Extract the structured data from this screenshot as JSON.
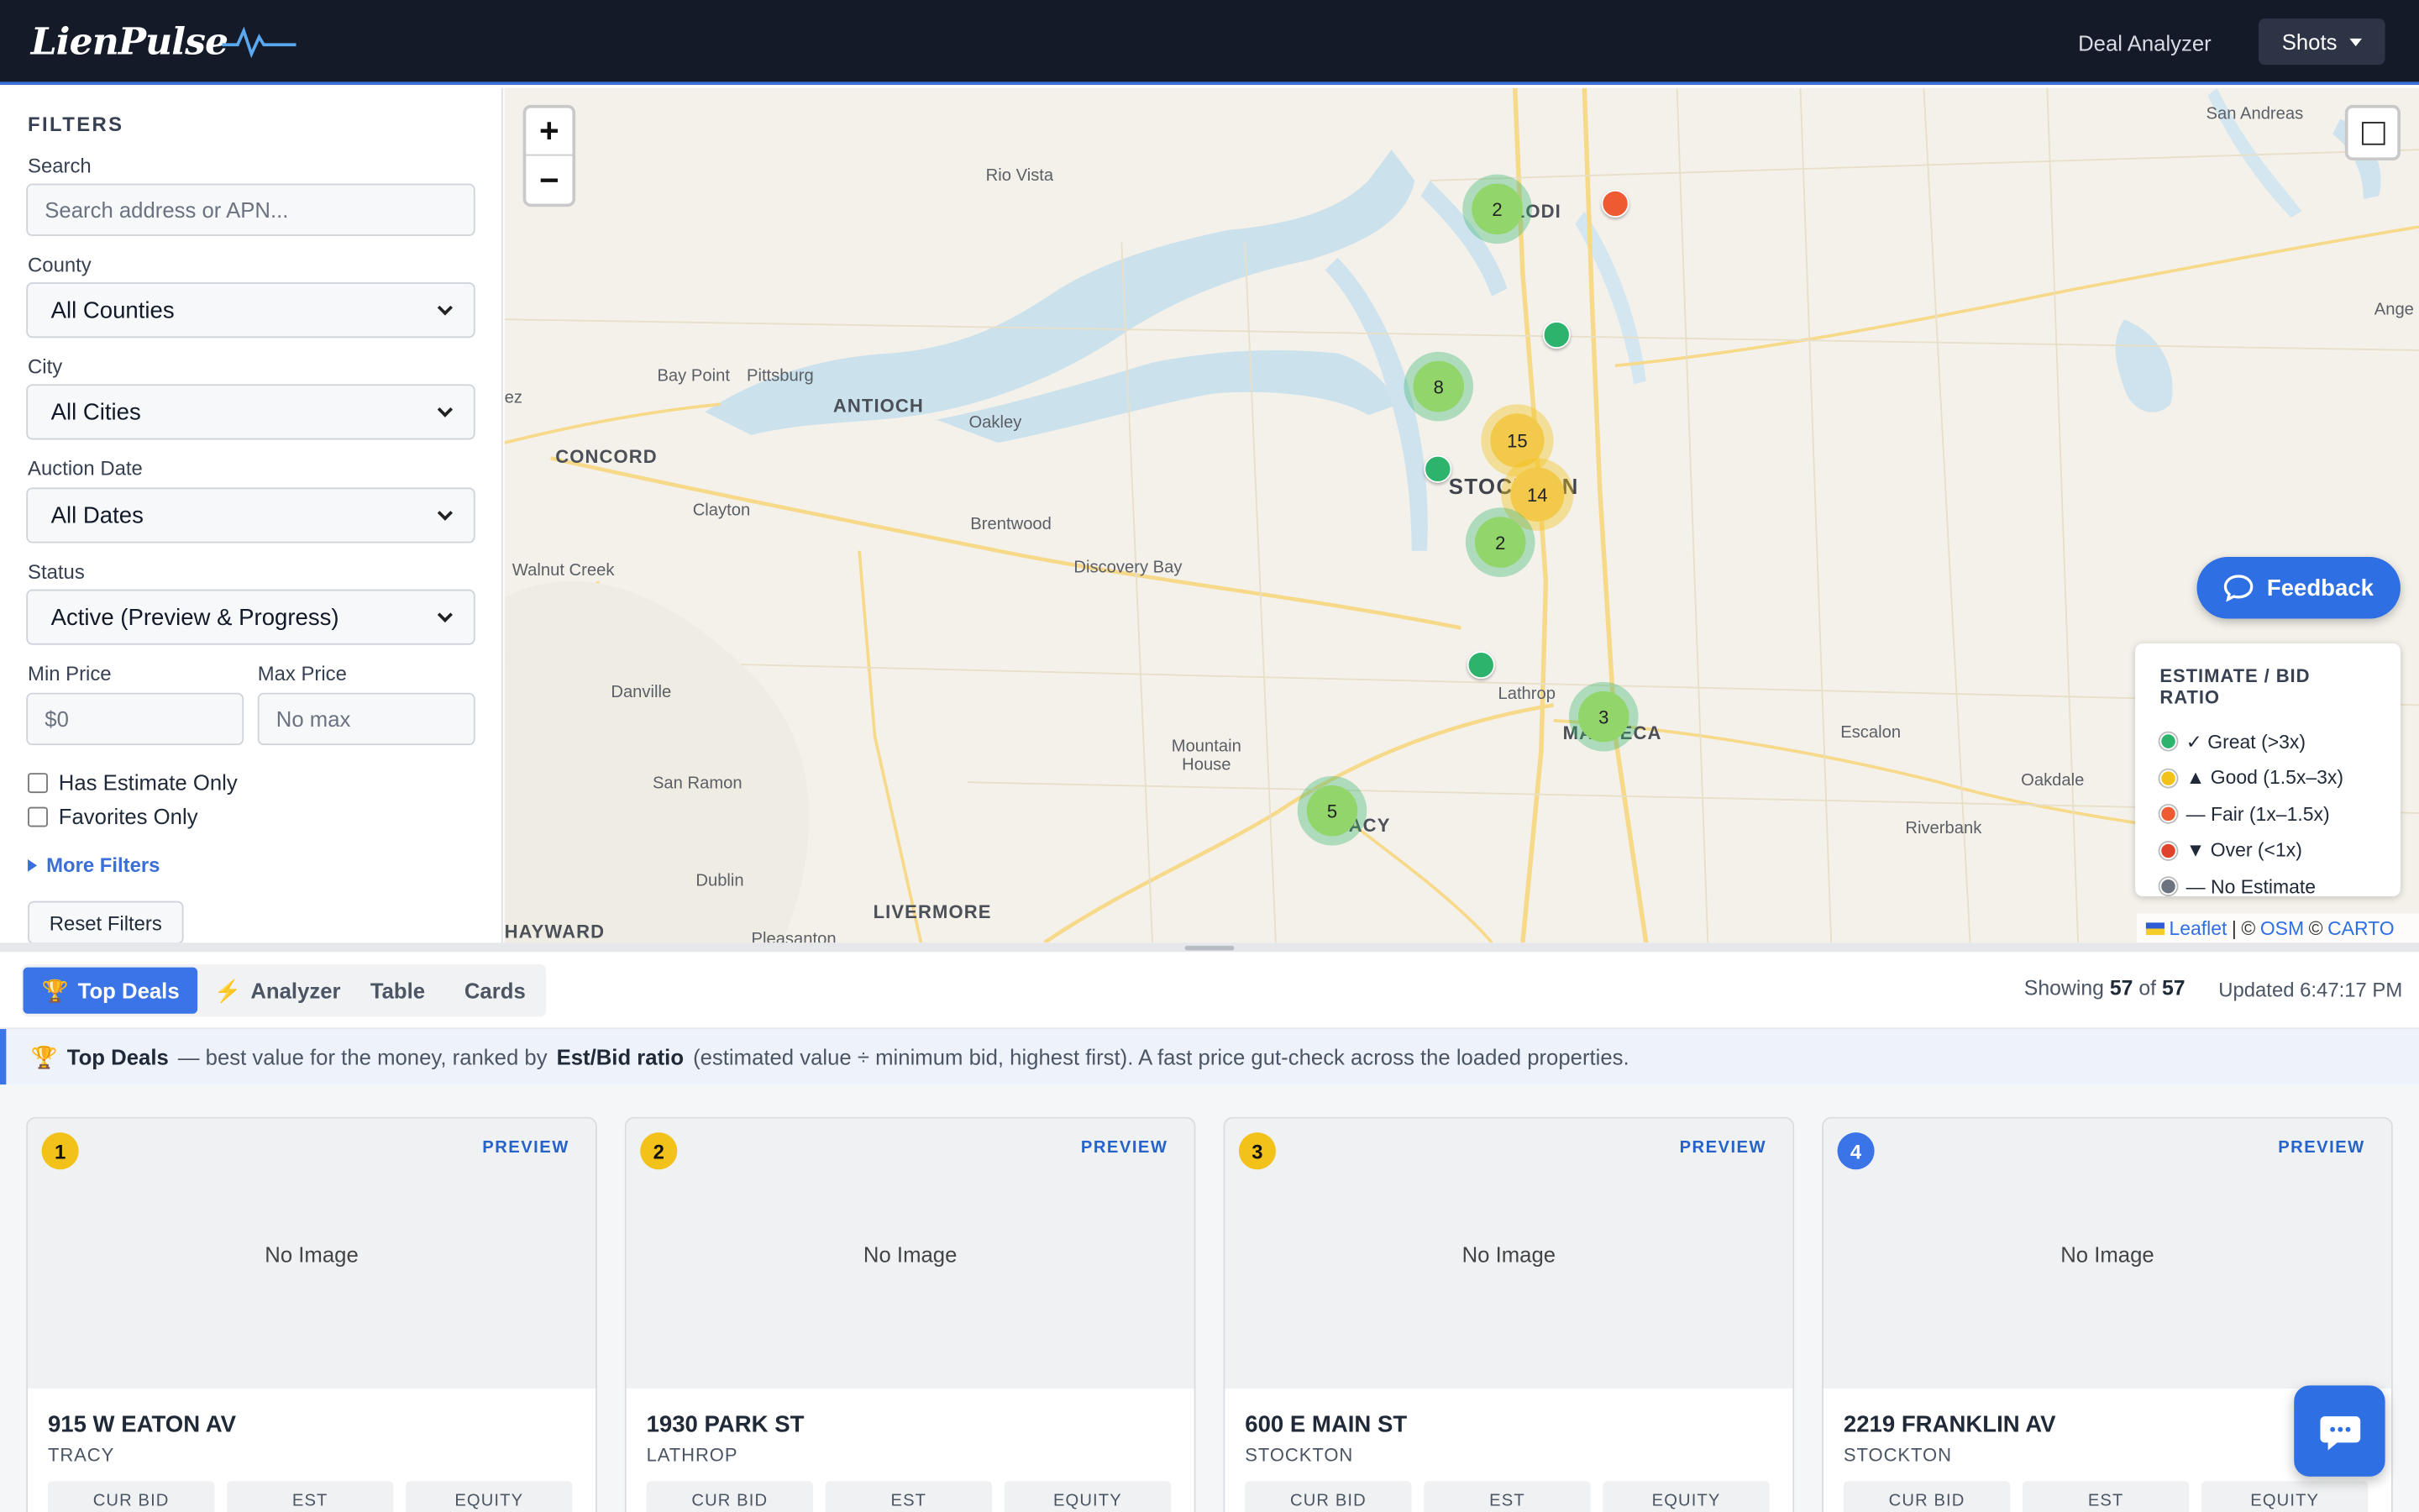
{
  "app": {
    "logo_text": "LienPulse",
    "nav_link": "Deal Analyzer",
    "menu_button": "Shots"
  },
  "filters": {
    "title": "FILTERS",
    "search": {
      "label": "Search",
      "placeholder": "Search address or APN..."
    },
    "county": {
      "label": "County",
      "value": "All Counties"
    },
    "city": {
      "label": "City",
      "value": "All Cities"
    },
    "auction_date": {
      "label": "Auction Date",
      "value": "All Dates"
    },
    "status": {
      "label": "Status",
      "value": "Active (Preview & Progress)"
    },
    "min_price": {
      "label": "Min Price",
      "placeholder": "$0"
    },
    "max_price": {
      "label": "Max Price",
      "placeholder": "No max"
    },
    "has_estimate": {
      "label": "Has Estimate Only",
      "checked": false
    },
    "favorites": {
      "label": "Favorites Only",
      "checked": false
    },
    "more_filters": "More Filters",
    "reset": "Reset Filters"
  },
  "map": {
    "zoom_in": "+",
    "zoom_out": "−",
    "places": [
      "San Andreas",
      "Rio Vista",
      "LODI",
      "Ange",
      "Bay Point",
      "Pittsburg",
      "ez",
      "ANTIOCH",
      "Oakley",
      "CONCORD",
      "STOCKTON",
      "Clayton",
      "Brentwood",
      "Walnut Creek",
      "Discovery Bay",
      "Danville",
      "Lathrop",
      "MANTECA",
      "Escalon",
      "Mountain House",
      "San Ramon",
      "TRACY",
      "Oakdale",
      "Riverbank",
      "Dublin",
      "LIVERMORE",
      "HAYWARD",
      "Pleasanton"
    ],
    "clusters": [
      {
        "count": "2",
        "tier": "great"
      },
      {
        "count": "8",
        "tier": "great"
      },
      {
        "count": "15",
        "tier": "good"
      },
      {
        "count": "14",
        "tier": "good"
      },
      {
        "count": "2",
        "tier": "great"
      },
      {
        "count": "3",
        "tier": "great"
      },
      {
        "count": "5",
        "tier": "great"
      }
    ],
    "markers": [
      {
        "tier": "fair"
      },
      {
        "tier": "great"
      },
      {
        "tier": "great"
      },
      {
        "tier": "great"
      }
    ],
    "feedback": "Feedback",
    "legend": {
      "title": "ESTIMATE / BID RATIO",
      "items": [
        {
          "label": "✓ Great (>3x)",
          "color": "#2db36b"
        },
        {
          "label": "▲ Good (1.5x–3x)",
          "color": "#f2c21b"
        },
        {
          "label": "— Fair (1x–1.5x)",
          "color": "#ee5a32"
        },
        {
          "label": "▼ Over (<1x)",
          "color": "#e0432c"
        },
        {
          "label": "— No Estimate",
          "color": "#6b7280"
        }
      ]
    },
    "attribution": {
      "leaflet": "Leaflet",
      "sep1": "|",
      "copy1": "©",
      "osm": "OSM",
      "copy2": "©",
      "carto": "CARTO"
    }
  },
  "colors": {
    "great": "#2db36b",
    "good": "#f2c21b",
    "fair": "#ee5a32",
    "accent": "#3b74e6",
    "header_bg": "#141a28"
  },
  "tabs": [
    {
      "icon": "🏆",
      "label": "Top Deals",
      "active": true
    },
    {
      "icon": "⚡",
      "label": "Analyzer",
      "active": false
    },
    {
      "icon": "",
      "label": "Table",
      "active": false
    },
    {
      "icon": "",
      "label": "Cards",
      "active": false
    }
  ],
  "results": {
    "showing_prefix": "Showing",
    "shown": "57",
    "of": "of",
    "total": "57",
    "updated": "Updated 6:47:17 PM"
  },
  "banner": {
    "icon": "🏆",
    "title": "Top Deals",
    "text_a": "— best value for the money, ranked by",
    "bold": "Est/Bid ratio",
    "text_b": "(estimated value ÷ minimum bid, highest first). A fast price gut-check across the loaded properties."
  },
  "cards": [
    {
      "rank": "1",
      "rank_color": "#f2c21b",
      "badge": "PREVIEW",
      "image": "No Image",
      "address": "915 W EATON AV",
      "city": "TRACY",
      "stats": [
        "CUR BID",
        "EST",
        "EQUITY"
      ]
    },
    {
      "rank": "2",
      "rank_color": "#f2c21b",
      "badge": "PREVIEW",
      "image": "No Image",
      "address": "1930 PARK ST",
      "city": "LATHROP",
      "stats": [
        "CUR BID",
        "EST",
        "EQUITY"
      ]
    },
    {
      "rank": "3",
      "rank_color": "#f2c21b",
      "badge": "PREVIEW",
      "image": "No Image",
      "address": "600 E MAIN ST",
      "city": "STOCKTON",
      "stats": [
        "CUR BID",
        "EST",
        "EQUITY"
      ]
    },
    {
      "rank": "4",
      "rank_color": "#3b74e6",
      "badge": "PREVIEW",
      "image": "No Image",
      "address": "2219 FRANKLIN AV",
      "city": "STOCKTON",
      "stats": [
        "CUR BID",
        "EST",
        "EQUITY"
      ]
    }
  ]
}
